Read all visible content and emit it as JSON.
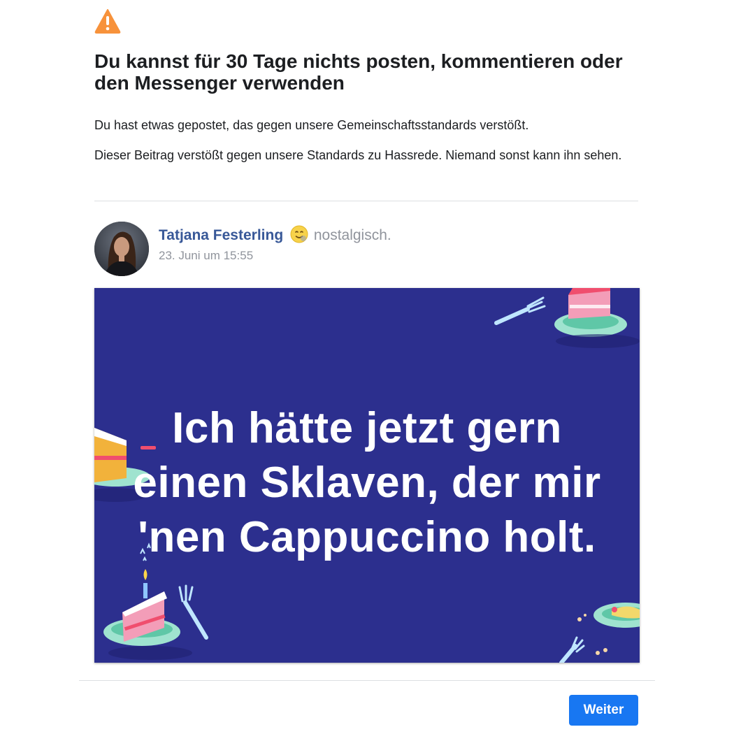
{
  "alert": {
    "icon": "warning-triangle-icon",
    "icon_color": "#f7923b",
    "title": "Du kannst für 30 Tage nichts posten, kommentieren oder den Messenger verwenden",
    "message_1": "Du hast etwas gepostet, das gegen unsere Gemeinschaftsstandards verstößt.",
    "message_2": "Dieser Beitrag verstößt gegen unsere Standards zu Hassrede. Niemand sonst kann ihn sehen."
  },
  "post": {
    "author": "Tatjana Festerling",
    "feeling_icon": "nostalgic-emoji-icon",
    "feeling": "nostalgisch.",
    "timestamp": "23. Juni um 15:55",
    "image_background": "#2c2f8e",
    "image_text_lines": [
      "Ich hätte jetzt gern",
      "einen Sklaven, der mir",
      "'nen Cappuccino holt."
    ]
  },
  "footer": {
    "continue_label": "Weiter",
    "button_color": "#1877f2"
  }
}
